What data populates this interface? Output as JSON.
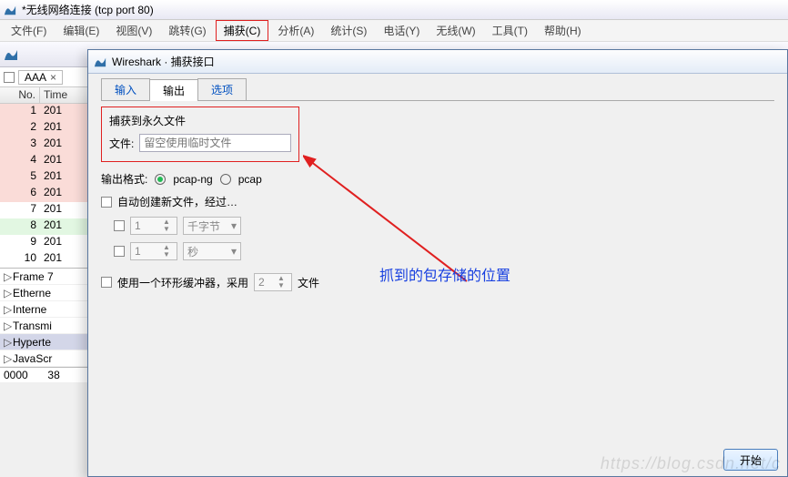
{
  "main_window": {
    "title": "*无线网络连接   (tcp port 80)"
  },
  "menu": {
    "file": "文件(F)",
    "edit": "编辑(E)",
    "view": "视图(V)",
    "go": "跳转(G)",
    "capture": "捕获(C)",
    "analyze": "分析(A)",
    "stats": "统计(S)",
    "telephony": "电话(Y)",
    "wireless": "无线(W)",
    "tools": "工具(T)",
    "help": "帮助(H)"
  },
  "filter": {
    "text": "AAA"
  },
  "packet_list": {
    "headers": {
      "no": "No.",
      "time": "Time"
    },
    "rows": [
      {
        "no": "1",
        "time": "201",
        "cls": "pink"
      },
      {
        "no": "2",
        "time": "201",
        "cls": "pink"
      },
      {
        "no": "3",
        "time": "201",
        "cls": "pink"
      },
      {
        "no": "4",
        "time": "201",
        "cls": "pink"
      },
      {
        "no": "5",
        "time": "201",
        "cls": "pink"
      },
      {
        "no": "6",
        "time": "201",
        "cls": "pink"
      },
      {
        "no": "7",
        "time": "201",
        "cls": "white"
      },
      {
        "no": "8",
        "time": "201",
        "cls": "green"
      },
      {
        "no": "9",
        "time": "201",
        "cls": "white"
      },
      {
        "no": "10",
        "time": "201",
        "cls": "white"
      }
    ]
  },
  "details": {
    "rows": [
      {
        "label": "Frame 7",
        "sel": false
      },
      {
        "label": "Etherne",
        "sel": false
      },
      {
        "label": "Interne",
        "sel": false
      },
      {
        "label": "Transmi",
        "sel": false
      },
      {
        "label": "Hyperte",
        "sel": true
      },
      {
        "label": "JavaScr",
        "sel": false
      }
    ]
  },
  "hex": {
    "line1_off": "0000",
    "line1_hex": "38"
  },
  "dialog": {
    "title": "Wireshark · 捕获接口",
    "tabs": {
      "input": "输入",
      "output": "输出",
      "options": "选项"
    },
    "perm_group": "捕获到永久文件",
    "file_label": "文件:",
    "file_placeholder": "留空使用临时文件",
    "fmt_label": "输出格式:",
    "fmt_pcapng": "pcap-ng",
    "fmt_pcap": "pcap",
    "auto_new": "自动创建新文件，经过…",
    "spin1_val": "1",
    "combo1_val": "千字节",
    "spin2_val": "1",
    "combo2_val": "秒",
    "ring_label": "使用一个环形缓冲器，采用",
    "ring_val": "2",
    "ring_unit": "文件",
    "start_btn": "开始"
  },
  "annotation": {
    "text": "抓到的包存储的位置"
  },
  "watermark": "https://blog.csdn.net/c"
}
